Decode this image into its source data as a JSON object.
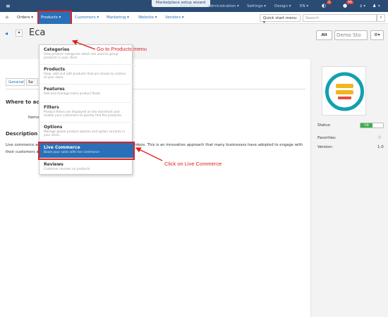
{
  "topbar": {
    "marketplace_setup": "Marketplace setup wizard",
    "addons": "Add-ons ▾",
    "administration": "Administration ▾",
    "settings": "Settings ▾",
    "design": "Design ▾",
    "language": "EN ▾",
    "cart_badge": "3",
    "msg_badge": "99",
    "currency": "$ ▾",
    "user": "▾"
  },
  "navbar": {
    "orders": "Orders ▾",
    "products": "Products ▾",
    "customers": "Customers ▾",
    "marketing": "Marketing ▾",
    "website": "Website ▾",
    "vendors": "Vendors ▾",
    "quick_start": "Quick start menu ▾",
    "search_placeholder": "Search"
  },
  "titlebar": {
    "title": "Eca",
    "all": "All",
    "store": "Demo Sto"
  },
  "content": {
    "tab_general": "General",
    "tab_se": "Se",
    "where_heading": "Where to acce",
    "items_text": "Items l",
    "desc_heading": "Description",
    "desc_line1": "Live commerce ac",
    "desc_line1b": "videos. This is an innovative approach that many businesses have adopted to engage with",
    "desc_line2": "their customers a"
  },
  "sidebar": {
    "status_label": "Status:",
    "status_value": "ON",
    "favorites_label": "Favorites:",
    "version_label": "Version:",
    "version_value": "1.0"
  },
  "dropdown": {
    "items": [
      {
        "title": "Categories",
        "desc": "View product categories which are used to group products in your store."
      },
      {
        "title": "Products",
        "desc": "View, add and edit products that are shown to visitors of your store."
      },
      {
        "title": "Features",
        "desc": "Add and manage extra product fields."
      },
      {
        "title": "Filters",
        "desc": "Product filters are displayed on the storefront and enable your customers to quickly find the products."
      },
      {
        "title": "Options",
        "desc": "Manage global product options and option variants in your store."
      },
      {
        "title": "Live Commerce",
        "desc": "Boost your sales with live commerce"
      },
      {
        "title": "Reviews",
        "desc": "Customer reviews on products"
      }
    ]
  },
  "annotations": {
    "go_products": "Go to Products menu",
    "click_live": "Click on Live Commerce"
  },
  "colors": {
    "topbar": "#2a4b73",
    "accent": "#2a70b8",
    "highlight_outline": "#e02020",
    "status_on": "#3cb04c"
  }
}
